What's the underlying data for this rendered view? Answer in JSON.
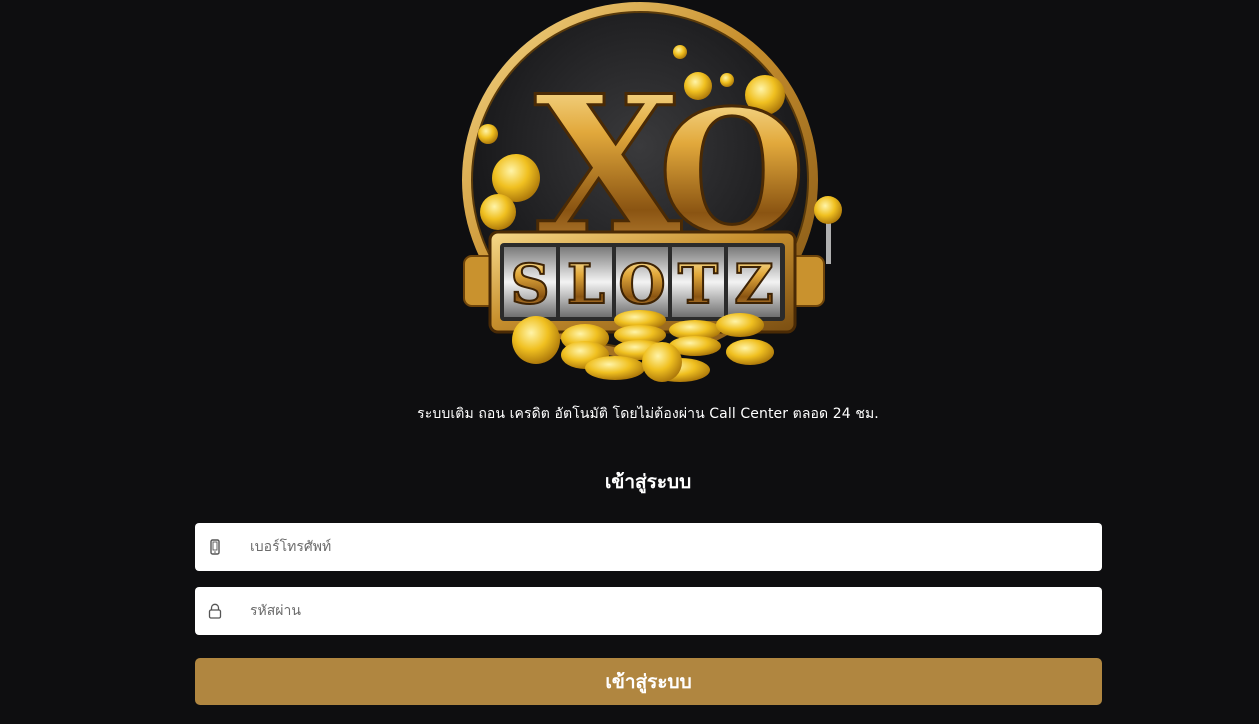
{
  "logo": {
    "brand_top": "XO",
    "brand_bottom": "SLOTZ"
  },
  "tagline": "ระบบเติม ถอน เครดิต อัตโนมัติ โดยไม่ต้องผ่าน Call Center ตลอด 24 ชม.",
  "login": {
    "title": "เข้าสู่ระบบ",
    "phone_placeholder": "เบอร์โทรศัพท์",
    "phone_icon": "mobile-phone-icon",
    "password_placeholder": "รหัสผ่าน",
    "password_icon": "lock-icon",
    "submit_label": "เข้าสู่ระบบ"
  },
  "colors": {
    "background": "#0e0e10",
    "accent": "#b08640",
    "field_bg": "#ffffff"
  }
}
